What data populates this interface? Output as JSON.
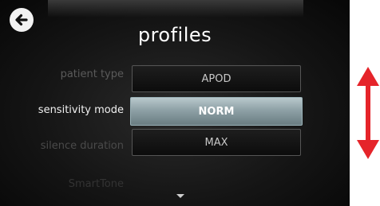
{
  "screen": {
    "title": "profiles",
    "back_icon": "back-arrow-icon"
  },
  "rows": {
    "patient_type_label": "patient type",
    "sensitivity_mode_label": "sensitivity mode",
    "silence_duration_label": "silence duration",
    "smarttone_label": "SmartTone"
  },
  "options": {
    "items": [
      "APOD",
      "NORM",
      "MAX"
    ],
    "selected": "NORM"
  },
  "indicators": {
    "scroll_down_icon": "chevron-down-icon",
    "swipe_icon": "vertical-double-arrow-icon",
    "swipe_color": "#e5242a"
  }
}
